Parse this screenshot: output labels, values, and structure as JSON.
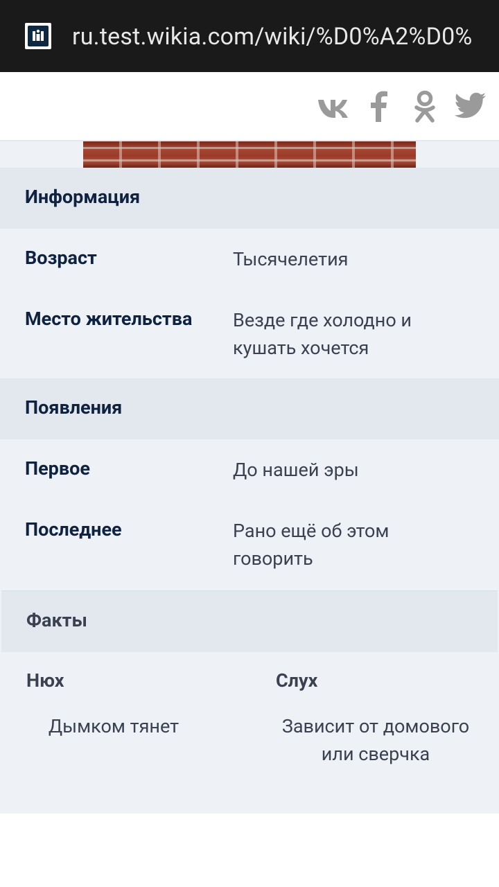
{
  "browser": {
    "url": "ru.test.wikia.com/wiki/%D0%A2%D0%",
    "site_icon": "wikia-icon"
  },
  "share": {
    "icons": [
      "vk-icon",
      "facebook-icon",
      "odnoklassniki-icon",
      "twitter-icon"
    ],
    "icon_color": "#999999"
  },
  "infobox": {
    "info_section": {
      "title": "Информация",
      "rows": [
        {
          "label": "Возраст",
          "value": "Тысячелетия"
        },
        {
          "label": "Место жительства",
          "value": "Везде где холодно и кушать хочется"
        }
      ]
    },
    "appearances_section": {
      "title": "Появления",
      "rows": [
        {
          "label": "Первое",
          "value": "До нашей эры"
        },
        {
          "label": "Последнее",
          "value": "Рано ещё об этом говорить"
        }
      ]
    },
    "facts_section": {
      "title": "Факты",
      "columns": [
        {
          "label": "Нюх",
          "value": "Дымком тянет"
        },
        {
          "label": "Слух",
          "value": "Зависит от домового или сверчка"
        }
      ]
    }
  },
  "colors": {
    "url_bar": "#1a1a1a",
    "header_bg": "#e3e8ef",
    "body_bg": "#eef2f7",
    "label": "#0f2340",
    "value": "#3a4150"
  }
}
